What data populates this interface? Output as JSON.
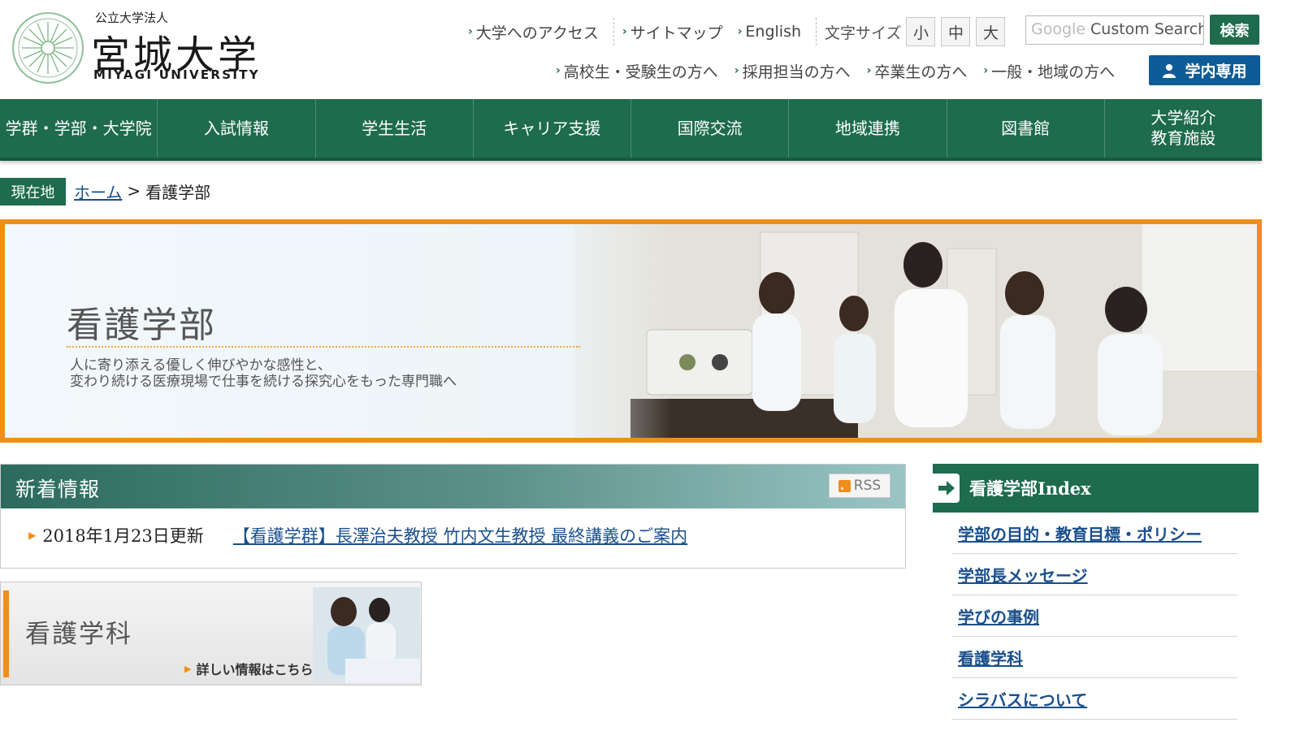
{
  "header": {
    "logo_pre": "公立大学法人",
    "logo_name": "宮城大学",
    "logo_en": "MIYAGI UNIVERSITY",
    "util_links": [
      "大学へのアクセス",
      "サイトマップ",
      "English"
    ],
    "font_size": {
      "label": "文字サイズ",
      "options": [
        "小",
        "中",
        "大"
      ]
    },
    "search": {
      "brand": "Google",
      "placeholder": "Custom Search",
      "button": "検索"
    },
    "audience_links": [
      "高校生・受験生の方へ",
      "採用担当の方へ",
      "卒業生の方へ",
      "一般・地域の方へ"
    ],
    "gakunai_button": "学内専用"
  },
  "gnav": [
    "学群・学部・大学院",
    "入試情報",
    "学生生活",
    "キャリア支援",
    "国際交流",
    "地域連携",
    "図書館",
    "大学紹介\n教育施設"
  ],
  "breadcrumb": {
    "label": "現在地",
    "home": "ホーム",
    "separator": ">",
    "current": "看護学部"
  },
  "hero": {
    "title": "看護学部",
    "subtitle": "人に寄り添える優しく伸びやかな感性と、\n変わり続ける医療現場で仕事を続ける探究心をもった専門職へ"
  },
  "news": {
    "title": "新着情報",
    "rss": "RSS",
    "items": [
      {
        "date": "2018年1月23日更新",
        "title": "【看護学群】長澤治夫教授 竹内文生教授 最終講義のご案内"
      }
    ]
  },
  "dept_card": {
    "title": "看護学科",
    "link": "詳しい情報はこちら"
  },
  "sidebar": {
    "title": "看護学部Index",
    "items": [
      "学部の目的・教育目標・ポリシー",
      "学部長メッセージ",
      "学びの事例",
      "看護学科",
      "シラバスについて"
    ]
  },
  "colors": {
    "brand_green": "#1e6b4e",
    "accent_orange": "#f08e1a",
    "link_blue": "#1a4f8c",
    "gakunai_blue": "#0e5c97"
  }
}
